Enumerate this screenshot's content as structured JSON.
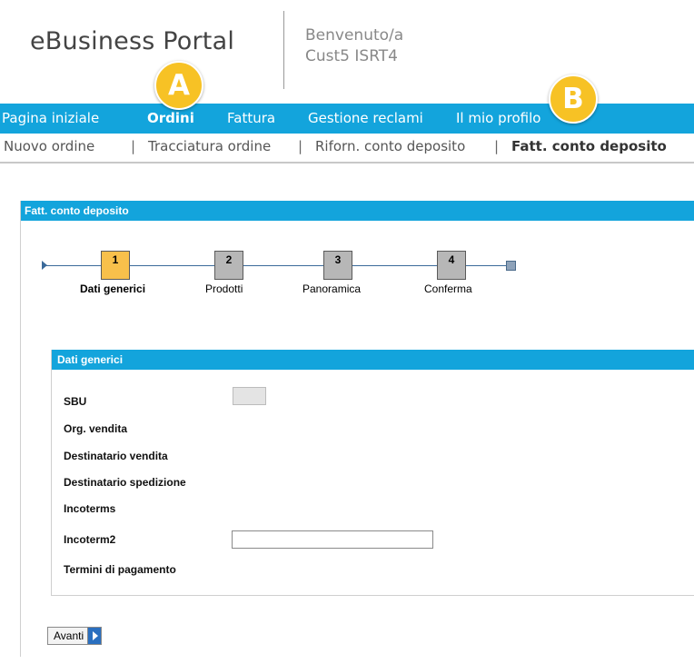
{
  "header": {
    "logo": "eBusiness Portal",
    "welcome_line1": "Benvenuto/a",
    "welcome_line2": "Cust5 ISRT4"
  },
  "main_nav": {
    "items": [
      {
        "label": "Pagina iniziale",
        "active": false
      },
      {
        "label": "Ordini",
        "active": true
      },
      {
        "label": "Fattura",
        "active": false
      },
      {
        "label": "Gestione reclami",
        "active": false
      },
      {
        "label": "Il mio profilo",
        "active": false
      }
    ]
  },
  "sub_nav": {
    "items": [
      {
        "label": "Nuovo ordine",
        "active": false
      },
      {
        "label": "Tracciatura ordine",
        "active": false
      },
      {
        "label": "Riforn. conto deposito",
        "active": false
      },
      {
        "label": "Fatt. conto deposito",
        "active": true
      }
    ],
    "separator": "|"
  },
  "annotations": {
    "a": "A",
    "b": "B"
  },
  "panel": {
    "title": "Fatt. conto deposito"
  },
  "steps": [
    {
      "number": "1",
      "label": "Dati generici",
      "state": "current"
    },
    {
      "number": "2",
      "label": "Prodotti",
      "state": "pending"
    },
    {
      "number": "3",
      "label": "Panoramica",
      "state": "pending"
    },
    {
      "number": "4",
      "label": "Conferma",
      "state": "pending"
    }
  ],
  "section": {
    "title": "Dati generici",
    "fields": {
      "sbu": "SBU",
      "org_vendita": "Org. vendita",
      "destinatario_vendita": "Destinatario vendita",
      "destinatario_spedizione": "Destinatario spedizione",
      "incoterms": "Incoterms",
      "incoterm2": "Incoterm2",
      "termini_pagamento": "Termini di pagamento"
    },
    "incoterm2_value": ""
  },
  "buttons": {
    "avanti": "Avanti"
  },
  "colors": {
    "nav_blue": "#13a4dc",
    "step_current": "#f8c04b",
    "step_pending": "#b7b7b7",
    "badge": "#f7c225"
  }
}
